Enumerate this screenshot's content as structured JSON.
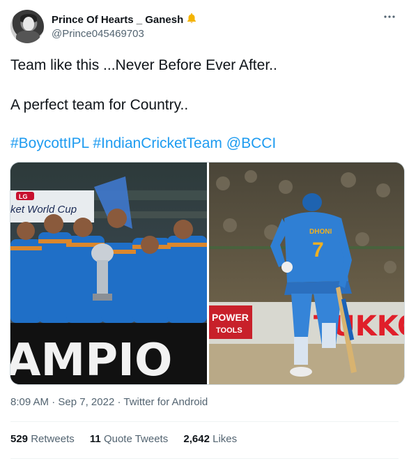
{
  "author": {
    "display_name": "Prince Of Hearts _ Ganesh",
    "badge_icon": "bell-icon",
    "handle": "@Prince045469703"
  },
  "more_icon": "ellipsis-icon",
  "tweet": {
    "line1": "Team like this ...Never Before Ever After..",
    "line2": "A perfect team for Country..",
    "hashtags": [
      "#BoycottIPL",
      "#IndianCricketTeam",
      "@BCCI"
    ]
  },
  "media": {
    "left_image": {
      "banner_logo": "LG",
      "banner_text": "ket World Cup",
      "bottom_text": "AMPIO"
    },
    "right_image": {
      "jersey_name": "DHONI",
      "jersey_number": "7",
      "ad_text": "POWER",
      "ad_subtext": "TOOLS",
      "ad_brand": "TUKKO"
    }
  },
  "meta": {
    "time": "8:09 AM",
    "date": "Sep 7, 2022",
    "source": "Twitter for Android"
  },
  "stats": {
    "retweets_count": "529",
    "retweets_label": "Retweets",
    "quotes_count": "11",
    "quotes_label": "Quote Tweets",
    "likes_count": "2,642",
    "likes_label": "Likes"
  },
  "colors": {
    "link": "#1d9bf0",
    "secondary": "#536471",
    "text": "#0f1419"
  }
}
